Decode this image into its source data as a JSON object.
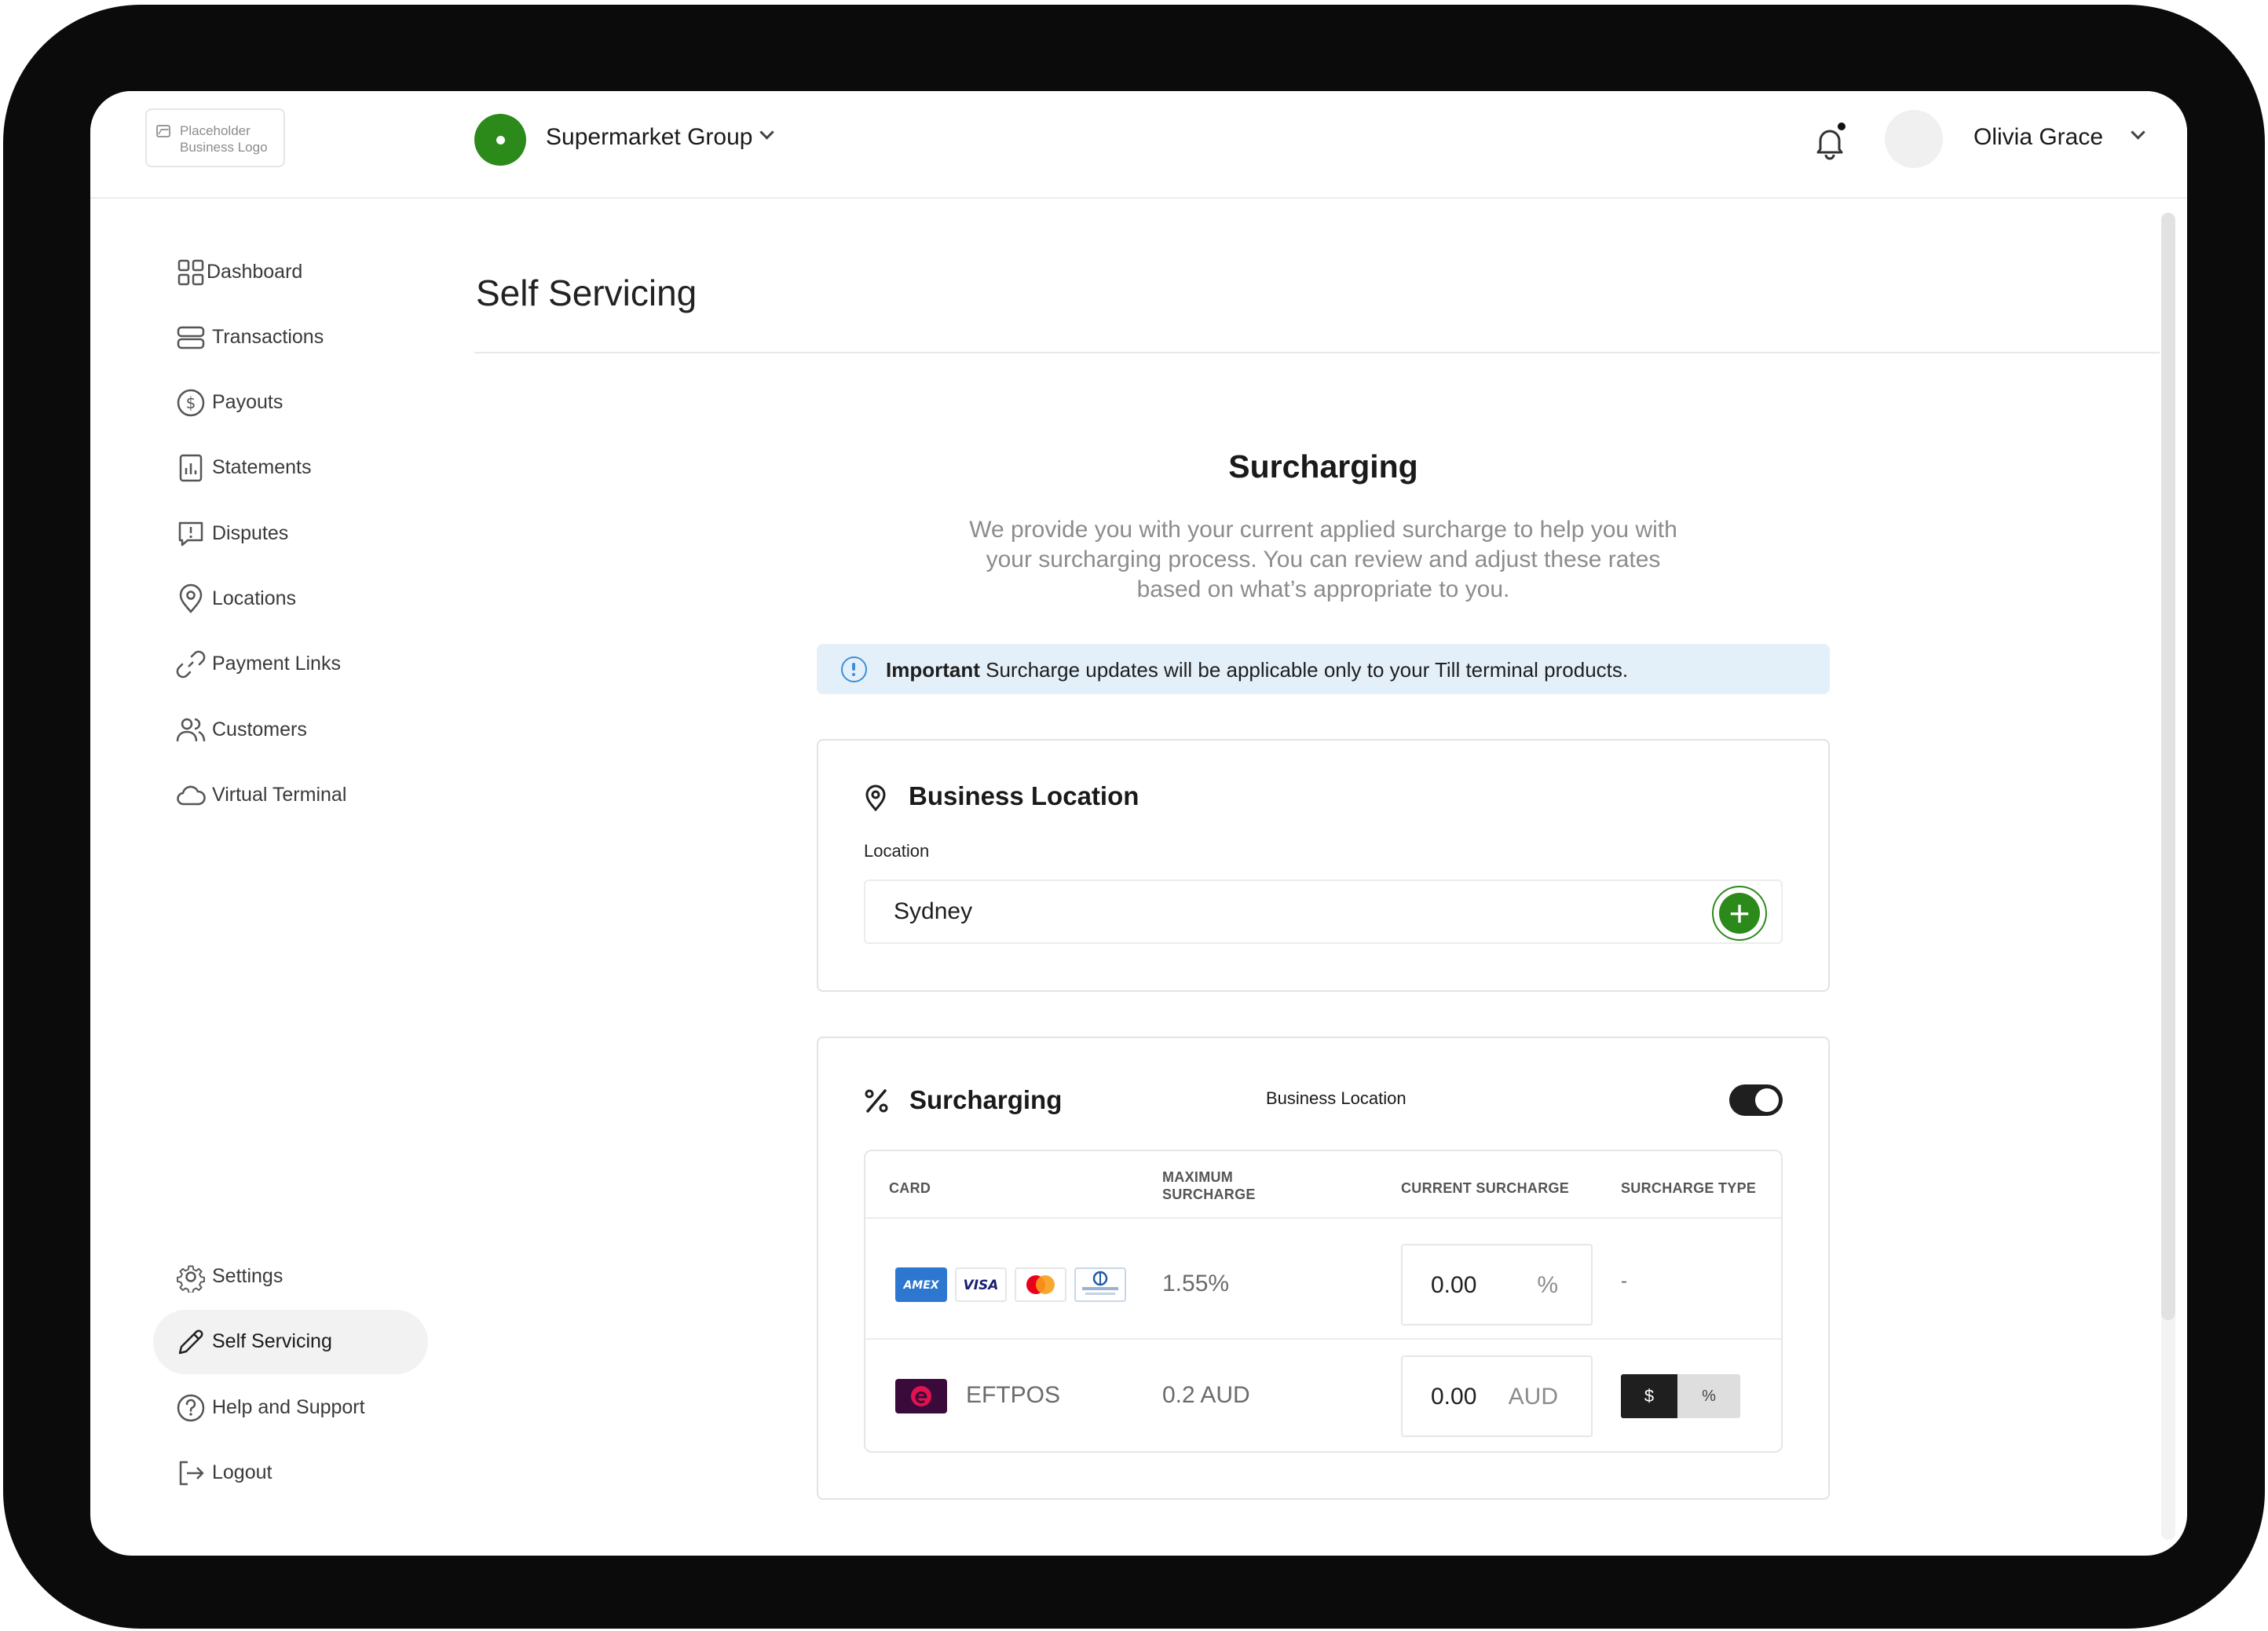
{
  "header": {
    "logo_text": "Placeholder Business Logo",
    "group_name": "Supermarket Group",
    "user_name": "Olivia Grace"
  },
  "sidebar": {
    "items": [
      {
        "label": "Dashboard",
        "icon": "grid-icon"
      },
      {
        "label": "Transactions",
        "icon": "list-icon"
      },
      {
        "label": "Payouts",
        "icon": "dollar-circle-icon"
      },
      {
        "label": "Statements",
        "icon": "chart-doc-icon"
      },
      {
        "label": "Disputes",
        "icon": "alert-message-icon"
      },
      {
        "label": "Locations",
        "icon": "map-pin-icon"
      },
      {
        "label": "Payment Links",
        "icon": "link-icon"
      },
      {
        "label": "Customers",
        "icon": "users-icon"
      },
      {
        "label": "Virtual Terminal",
        "icon": "cloud-icon"
      }
    ],
    "bottom_items": [
      {
        "label": "Settings",
        "icon": "gear-icon"
      },
      {
        "label": "Self Servicing",
        "icon": "pencil-icon",
        "active": true
      },
      {
        "label": "Help and Support",
        "icon": "question-circle-icon"
      },
      {
        "label": "Logout",
        "icon": "logout-icon"
      }
    ]
  },
  "main": {
    "page_title": "Self Servicing",
    "section_title": "Surcharging",
    "intro": "We provide you with your current applied surcharge to help you with your surcharging process. You can review and adjust these rates based on what’s appropriate to you.",
    "notice": {
      "strong": "Important",
      "text": " Surcharge updates will be applicable only to your Till terminal products."
    },
    "location_card": {
      "title": "Business Location",
      "label": "Location",
      "value": "Sydney"
    },
    "surcharging_card": {
      "title": "Surcharging",
      "toggle_label": "Business Location",
      "toggle_on": true,
      "columns": [
        "CARD",
        "MAXIMUM SURCHARGE",
        "CURRENT SURCHARGE",
        "SURCHARGE TYPE"
      ],
      "rows": [
        {
          "cards": [
            "AMEX",
            "VISA",
            "Mastercard",
            "Diners Club"
          ],
          "max_surcharge": "1.55%",
          "current_value": "0.00",
          "current_unit": "%",
          "type": "-"
        },
        {
          "card_name": "EFTPOS",
          "max_surcharge": "0.2 AUD",
          "current_value": "0.00",
          "current_unit": "AUD",
          "type_options": [
            "$",
            "%"
          ],
          "type_selected": "$"
        }
      ]
    }
  },
  "colors": {
    "brand_green": "#2b8a1a",
    "notice_bg": "#e4f0f9",
    "info_blue": "#3c8fd6",
    "amex_blue": "#2e77d0",
    "eftpos_purple": "#3a0b3a"
  }
}
